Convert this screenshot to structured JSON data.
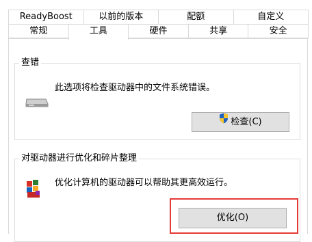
{
  "tabs": {
    "row_top": [
      "ReadyBoost",
      "以前的版本",
      "配额",
      "自定义"
    ],
    "row_bottom": [
      "常规",
      "工具",
      "硬件",
      "共享",
      "安全"
    ],
    "active": "工具"
  },
  "error_check": {
    "group_title": "查错",
    "description": "此选项将检查驱动器中的文件系统错误。",
    "button_label": "检查(C)",
    "icon": "drive-icon",
    "button_icon": "uac-shield-icon"
  },
  "optimize": {
    "group_title": "对驱动器进行优化和碎片整理",
    "description": "优化计算机的驱动器可以帮助其更高效运行。",
    "button_label": "优化(O)",
    "icon": "defrag-icon"
  },
  "colors": {
    "highlight": "#e53935",
    "button_bg": "#e1e1e1",
    "border": "#d9d9d9"
  }
}
